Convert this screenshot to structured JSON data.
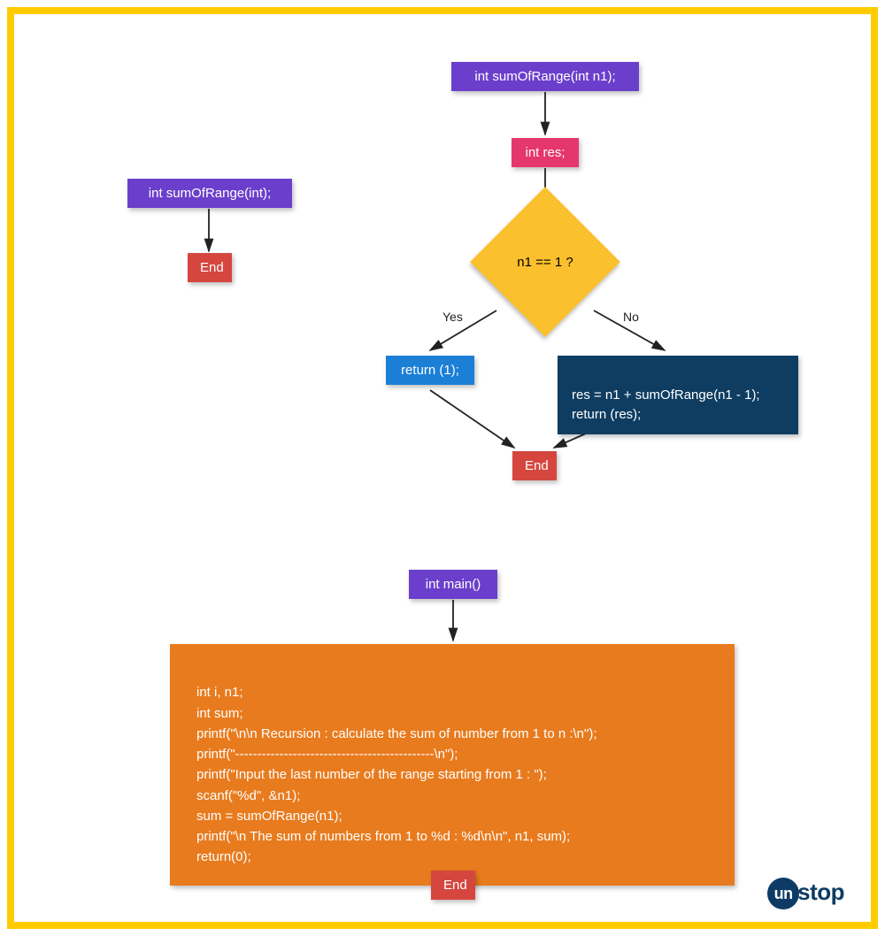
{
  "nodes": {
    "declare_fn": "int sumOfRange(int);",
    "declare_end": "End",
    "fn_header": "int sumOfRange(int n1);",
    "int_res": "int res;",
    "decision": "n1 == 1 ?",
    "yes_label": "Yes",
    "no_label": "No",
    "return1": "return (1);",
    "recurse": "res = n1 + sumOfRange(n1 - 1);\nreturn (res);",
    "fn_end": "End",
    "main_header": "int main()",
    "main_body": "int i, n1;\nint sum;\nprintf(\"\\n\\n Recursion : calculate the sum of number from 1 to n :\\n\");\nprintf(\"---------------------------------------------\\n\");\nprintf(\"Input the last number of the range starting from 1 : \");\nscanf(\"%d\", &n1);\nsum = sumOfRange(n1);\nprintf(\"\\n The sum of numbers from 1 to %d : %d\\n\\n\", n1, sum);\nreturn(0);",
    "main_end": "End"
  },
  "brand": {
    "prefix": "un",
    "suffix": "stop"
  },
  "colors": {
    "border": "#FFCC00",
    "purple": "#6B3FCB",
    "pink": "#E5366E",
    "red": "#D5463E",
    "diamond": "#FBC02D",
    "blue": "#1C7FD6",
    "navy": "#0F3D61",
    "orange": "#E87B1E",
    "brand": "#0D3B66"
  }
}
